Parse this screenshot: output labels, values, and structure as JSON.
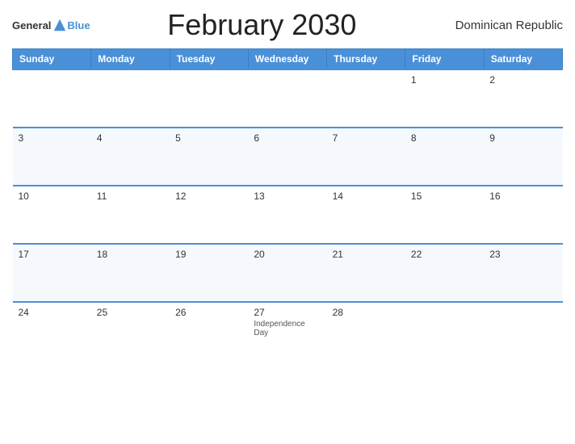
{
  "header": {
    "title": "February 2030",
    "country": "Dominican Republic",
    "logo_general": "General",
    "logo_blue": "Blue"
  },
  "weekdays": [
    "Sunday",
    "Monday",
    "Tuesday",
    "Wednesday",
    "Thursday",
    "Friday",
    "Saturday"
  ],
  "rows": [
    [
      {
        "day": "",
        "event": ""
      },
      {
        "day": "",
        "event": ""
      },
      {
        "day": "",
        "event": ""
      },
      {
        "day": "",
        "event": ""
      },
      {
        "day": "",
        "event": ""
      },
      {
        "day": "1",
        "event": ""
      },
      {
        "day": "2",
        "event": ""
      }
    ],
    [
      {
        "day": "3",
        "event": ""
      },
      {
        "day": "4",
        "event": ""
      },
      {
        "day": "5",
        "event": ""
      },
      {
        "day": "6",
        "event": ""
      },
      {
        "day": "7",
        "event": ""
      },
      {
        "day": "8",
        "event": ""
      },
      {
        "day": "9",
        "event": ""
      }
    ],
    [
      {
        "day": "10",
        "event": ""
      },
      {
        "day": "11",
        "event": ""
      },
      {
        "day": "12",
        "event": ""
      },
      {
        "day": "13",
        "event": ""
      },
      {
        "day": "14",
        "event": ""
      },
      {
        "day": "15",
        "event": ""
      },
      {
        "day": "16",
        "event": ""
      }
    ],
    [
      {
        "day": "17",
        "event": ""
      },
      {
        "day": "18",
        "event": ""
      },
      {
        "day": "19",
        "event": ""
      },
      {
        "day": "20",
        "event": ""
      },
      {
        "day": "21",
        "event": ""
      },
      {
        "day": "22",
        "event": ""
      },
      {
        "day": "23",
        "event": ""
      }
    ],
    [
      {
        "day": "24",
        "event": ""
      },
      {
        "day": "25",
        "event": ""
      },
      {
        "day": "26",
        "event": ""
      },
      {
        "day": "27",
        "event": "Independence Day"
      },
      {
        "day": "28",
        "event": ""
      },
      {
        "day": "",
        "event": ""
      },
      {
        "day": "",
        "event": ""
      }
    ]
  ]
}
